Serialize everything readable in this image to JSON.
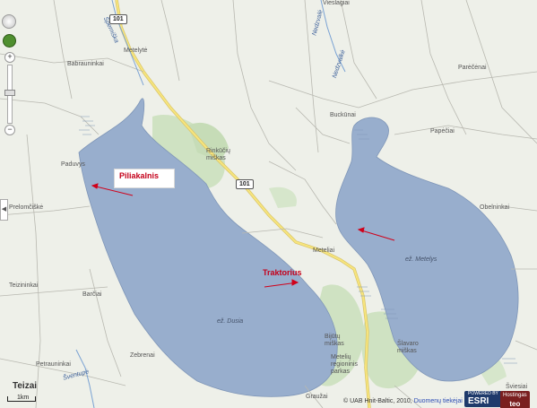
{
  "labels": {
    "babrauninkai": "Babrauninkai",
    "metelyte": "Metelytė",
    "paduvys": "Paduvys",
    "prelomciske": "Prelomčiškė",
    "teizininkai": "Teizininkai",
    "barciai": "Barčiai",
    "petrauninkai": "Petrauninkai",
    "zebrenai": "Zebrenai",
    "teizai": "Teizai",
    "rinkuciu_miskas": "Rinkūčių miškas",
    "buckunai": "Buckūnai",
    "parecenai": "Parėčėnai",
    "papeciai": "Papėčiai",
    "obelninkai": "Obelninkai",
    "meteliai": "Meteliai",
    "bijutu_miskas": "Bijūtų miškas",
    "svaro_miskas": "Šlavaro miškas",
    "metelu_regioninis_parkas": "Metelių regioninis parkas",
    "grauzai": "Graužai",
    "sviesiai": "Šviesiai",
    "vieslagiai": "Vieslagiai"
  },
  "roads": {
    "route_shield_top": "101",
    "route_shield_mid": "101",
    "sperniska": "Šperniška",
    "nedzvale": "Nedzvalė",
    "nedzvalke": "Nedzvalkė",
    "sventupe": "Šventupė"
  },
  "lakes": {
    "duja": "ež. Dusia",
    "metelys": "ež. Metelys"
  },
  "annotations": {
    "piliakalnis": "Piliakalnis",
    "traktorius": "Traktorius",
    "arrow_color": "#d0021b"
  },
  "controls": {
    "pan_icon": "pan-icon",
    "globe_icon": "globe-icon",
    "zoom_in": "+",
    "zoom_out": "−",
    "scale": "1km"
  },
  "attribution": {
    "copyright": "© UAB Hnit-Baltic, 2010,",
    "link": "Duomenų tiekėjai",
    "esri_top": "POWERED BY",
    "esri": "ESRI",
    "host_top": "Hostingas",
    "host": "teo"
  },
  "colors": {
    "water": "#98aecd",
    "land": "#eef0e9",
    "forest": "#cfe2c2",
    "road_main": "#f7e57d",
    "road_minor": "#ffffff",
    "annotation": "#c4001a"
  }
}
